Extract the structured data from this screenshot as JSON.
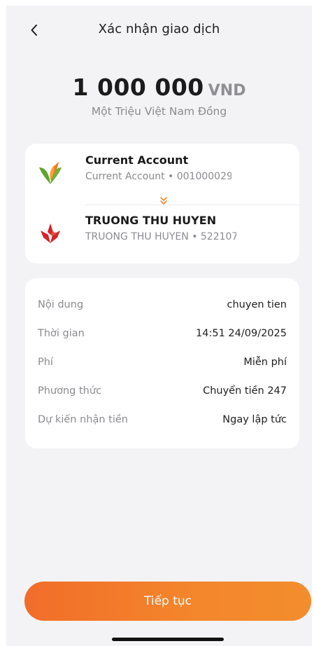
{
  "header": {
    "title": "Xác nhận giao dịch"
  },
  "amount": {
    "value": "1 000 000",
    "currency": "VND",
    "in_words": "Một Triệu Việt Nam Đồng"
  },
  "source_account": {
    "name": "Current Account",
    "detail": "Current Account • 001000029"
  },
  "destination_account": {
    "name": "TRUONG THU HUYEN",
    "detail": "TRUONG THU HUYEN • 522107"
  },
  "details": [
    {
      "label": "Nội dung",
      "value": "chuyen tien"
    },
    {
      "label": "Thời gian",
      "value": "14:51 24/09/2025"
    },
    {
      "label": "Phí",
      "value": "Miễn phí"
    },
    {
      "label": "Phương thức",
      "value": "Chuyển tiền 247"
    },
    {
      "label": "Dự kiến nhận tiền",
      "value": "Ngay lập tức"
    }
  ],
  "actions": {
    "continue_label": "Tiếp tục"
  },
  "colors": {
    "accent": "#f4862b",
    "background": "#f3f3f6",
    "card": "#ffffff",
    "muted_text": "#8b8b90"
  },
  "icons": {
    "back": "chevron-left-icon",
    "flow": "double-chevron-down-icon",
    "source_logo": "bank-leaf-logo",
    "destination_logo": "bank-star-logo"
  }
}
